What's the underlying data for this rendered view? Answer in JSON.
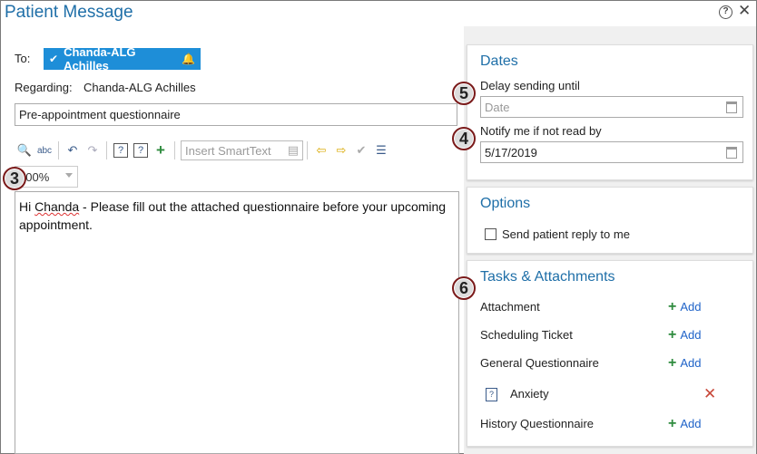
{
  "window": {
    "title": "Patient Message",
    "help_glyph": "?",
    "close_glyph": "✕"
  },
  "compose": {
    "to_label": "To:",
    "recipient": "Chanda-ALG Achilles",
    "regarding_label": "Regarding:",
    "regarding_value": "Chanda-ALG Achilles",
    "subject": "Pre-appointment questionnaire",
    "smarttext_placeholder": "Insert SmartText",
    "zoom": "100%",
    "body_pre": "Hi ",
    "body_name": "Chanda",
    "body_post": " - Please fill out the attached questionnaire before your upcoming appointment."
  },
  "badges": {
    "zoom": "3",
    "notify": "4",
    "delay": "5",
    "tasks": "6"
  },
  "dates": {
    "title": "Dates",
    "delay_label": "Delay sending until",
    "delay_placeholder": "Date",
    "notify_label": "Notify me if not read by",
    "notify_value": "5/17/2019"
  },
  "options": {
    "title": "Options",
    "send_reply_label": "Send patient reply to me"
  },
  "tasks": {
    "title": "Tasks & Attachments",
    "add_label": "Add",
    "items": [
      {
        "label": "Attachment"
      },
      {
        "label": "Scheduling Ticket"
      },
      {
        "label": "General Questionnaire"
      },
      {
        "label": "History Questionnaire"
      }
    ],
    "attached": "Anxiety"
  },
  "colors": {
    "accent": "#1f6fa8",
    "chip": "#1e8ed8",
    "add_plus": "#2e8b3e",
    "remove": "#c8483a"
  }
}
